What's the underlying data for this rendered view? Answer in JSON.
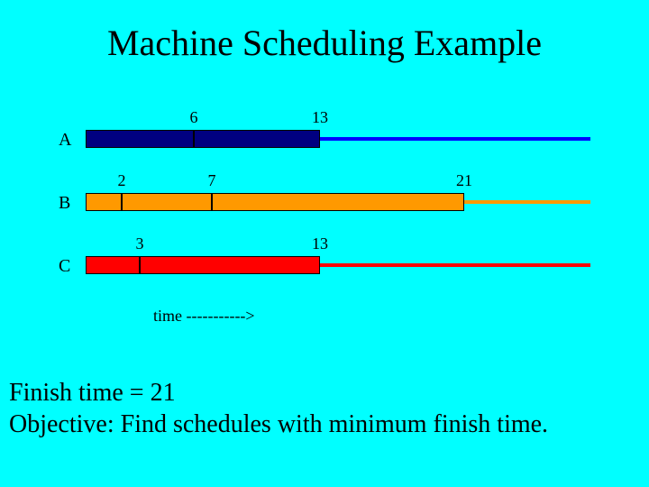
{
  "title": "Machine Scheduling Example",
  "axis_label": "time ----------->",
  "body_line1": "Finish time = 21",
  "body_line2": "Objective: Find schedules with minimum finish time.",
  "machines": {
    "a": {
      "label": "A",
      "seg1_end": "6",
      "seg2_end": "13"
    },
    "b": {
      "label": "B",
      "seg1_end": "2",
      "seg2_end": "7",
      "seg3_end": "21"
    },
    "c": {
      "label": "C",
      "seg1_end": "3",
      "seg2_end": "13"
    }
  },
  "chart_data": {
    "type": "bar",
    "title": "Machine Scheduling Example",
    "xlabel": "time",
    "ylabel": "",
    "xlim": [
      0,
      21
    ],
    "machines": [
      {
        "name": "A",
        "color": "#000080",
        "line_color": "#0000ff",
        "jobs": [
          {
            "start": 0,
            "end": 6
          },
          {
            "start": 6,
            "end": 13
          }
        ]
      },
      {
        "name": "B",
        "color": "#ff9900",
        "line_color": "#ff9900",
        "jobs": [
          {
            "start": 0,
            "end": 2
          },
          {
            "start": 2,
            "end": 7
          },
          {
            "start": 7,
            "end": 21
          }
        ]
      },
      {
        "name": "C",
        "color": "#ff0000",
        "line_color": "#ff0000",
        "jobs": [
          {
            "start": 0,
            "end": 3
          },
          {
            "start": 3,
            "end": 13
          }
        ]
      }
    ],
    "finish_time": 21
  }
}
